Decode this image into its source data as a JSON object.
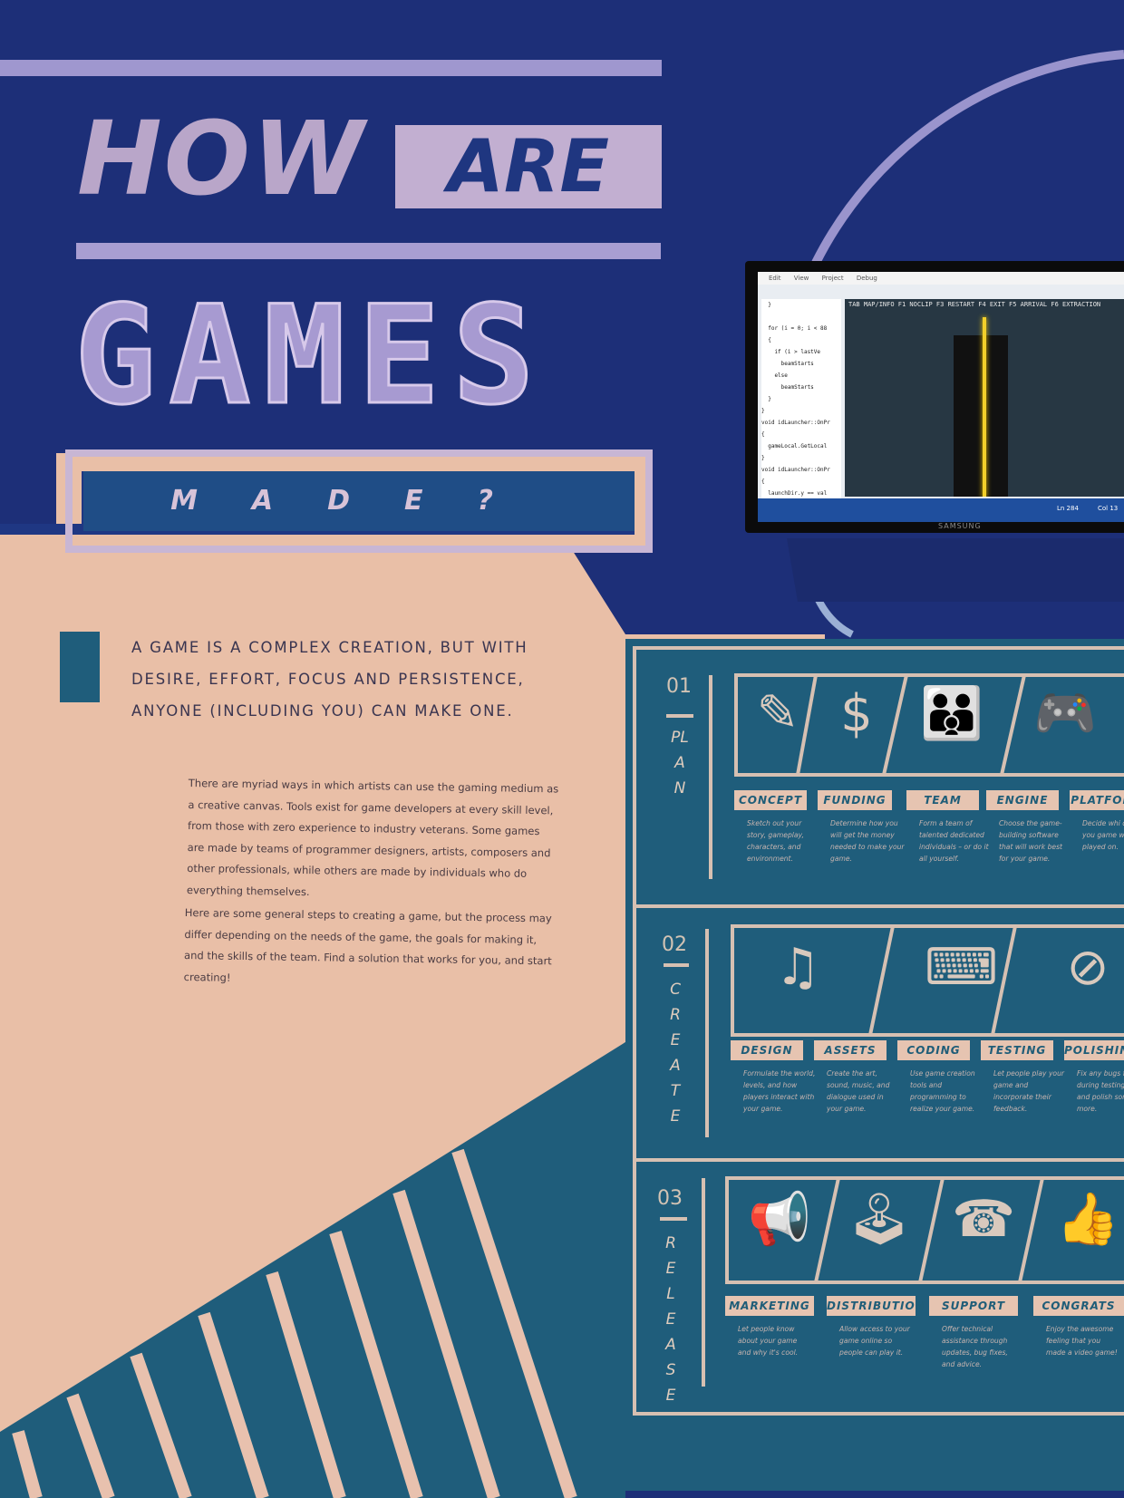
{
  "title": {
    "how": "HOW",
    "are": "ARE",
    "games": "GAMES",
    "made": "MADE?"
  },
  "lead_text": "A GAME IS A COMPLEX CREATION, BUT WITH DESIRE, EFFORT, FOCUS AND PERSISTENCE, ANYONE (INCLUDING YOU) CAN MAKE ONE.",
  "body": [
    "There are myriad ways in which artists can use the gaming medium as a creative canvas. Tools exist for game developers at every skill level, from those with zero experience to industry veterans. Some games are made by teams of programmer designers, artists, composers and other professionals, while others are made by individuals who do everything themselves.",
    "Here are some general steps to creating a game, but the process may differ depending on the needs of the game, the goals for making it, and the skills of the team. Find a solution that works for you, and start creating!"
  ],
  "monitor": {
    "menu": [
      "Edit",
      "View",
      "Project",
      "Debug"
    ],
    "hud": "TAB MAP/INFO  F1 NOCLIP   F3 RESTART  F4 EXIT    F5 ARRIVAL  F6 EXTRACTION",
    "code": "  }\n\n  for (i = 0; i < 88\n  {\n    if (i > lastVe\n      beamStarts\n    else\n      beamStarts\n  }\n}\nvoid idLauncher::OnPr\n{\n  gameLocal.GetLocal\n}\nvoid idLauncher::OnPr\n{\n  launchDir.y == val\n\n  idAngles ang = dir",
    "status": [
      "Ln 284",
      "Col 13"
    ],
    "brand": "SAMSUNG"
  },
  "phases": [
    {
      "number": "01",
      "label": "PLAN",
      "icons": [
        "pen-icon",
        "dollar-icon",
        "team-icon",
        "devices-icon"
      ],
      "steps": [
        {
          "tag": "CONCEPT",
          "desc": "Sketch out your story, gameplay, characters, and environment."
        },
        {
          "tag": "FUNDING",
          "desc": "Determine how you will get the money needed to make your game."
        },
        {
          "tag": "TEAM",
          "desc": "Form a team of talented dedicated individuals – or do it all yourself."
        },
        {
          "tag": "ENGINE",
          "desc": "Choose the game-building software that will work best for your game."
        },
        {
          "tag": "PLATFOR",
          "desc": "Decide whi devices you game will b played on."
        }
      ]
    },
    {
      "number": "02",
      "label": "CREATE",
      "icons": [
        "art-icon",
        "code-icon",
        "no-bug-icon"
      ],
      "steps": [
        {
          "tag": "DESIGN",
          "desc": "Formulate the world, levels, and how players interact with your game."
        },
        {
          "tag": "ASSETS",
          "desc": "Create the art, sound, music, and dialogue used in your game."
        },
        {
          "tag": "CODING",
          "desc": "Use game creation tools and programming to realize your game."
        },
        {
          "tag": "TESTING",
          "desc": "Let people play your game and incorporate their feedback."
        },
        {
          "tag": "POLISHIN",
          "desc": "Fix any bugs found during testing. Test and polish some more."
        }
      ]
    },
    {
      "number": "03",
      "label": "RELEASE",
      "icons": [
        "megaphone-icon",
        "www-icon",
        "phone-icon",
        "thumbs-up-icon"
      ],
      "steps": [
        {
          "tag": "MARKETING",
          "desc": "Let people know about your game and why it's cool."
        },
        {
          "tag": "DISTRIBUTION",
          "desc": "Allow access to your game online so people can play it."
        },
        {
          "tag": "SUPPORT",
          "desc": "Offer technical assistance through updates, bug fixes, and advice."
        },
        {
          "tag": "CONGRATS",
          "desc": "Enjoy the awesome feeling that you made a video game!"
        }
      ]
    }
  ]
}
